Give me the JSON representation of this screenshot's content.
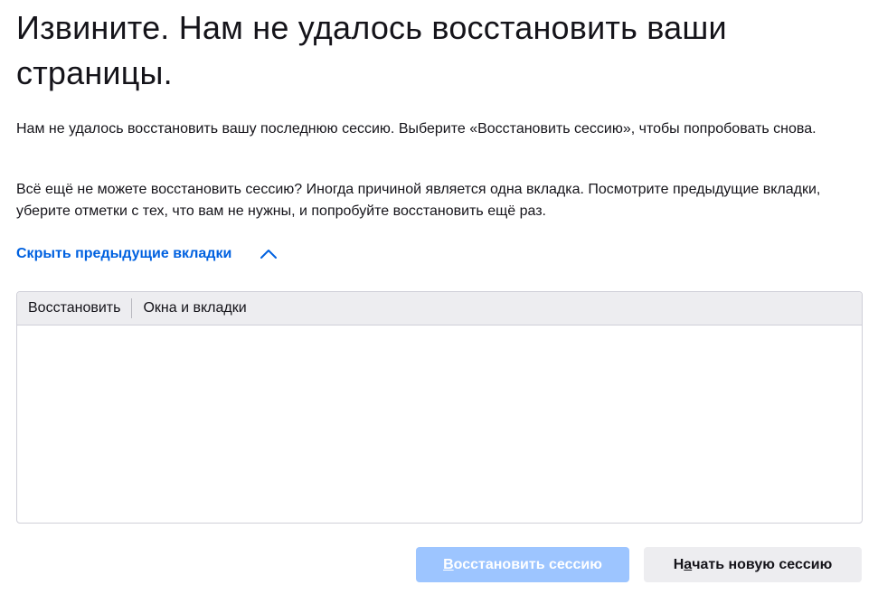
{
  "title": "Извините. Нам не удалось восстановить ваши страницы.",
  "paragraph1": "Нам не удалось восстановить вашу последнюю сессию. Выберите «Восстановить сессию», чтобы попробовать снова.",
  "paragraph2": "Всё ещё не можете восстановить сессию? Иногда причиной является одна вкладка. Посмотрите предыдущие вкладки, уберите отметки с тех, что вам не нужны, и попробуйте восстановить ещё раз.",
  "toggle": {
    "label": "Скрыть предыдущие вкладки",
    "icon": "chevron-up-icon"
  },
  "table": {
    "columns": [
      "Восстановить",
      "Окна и вкладки"
    ],
    "rows": []
  },
  "buttons": {
    "restore": {
      "access_key": "В",
      "rest": "осстановить сессию",
      "enabled": false
    },
    "new_session": {
      "pre": "Н",
      "access_key": "а",
      "rest": "чать новую сессию"
    }
  },
  "colors": {
    "link": "#0061e0",
    "primary_disabled": "#9dc5ff",
    "secondary": "#ededf0",
    "header_bg": "#ededf0"
  }
}
